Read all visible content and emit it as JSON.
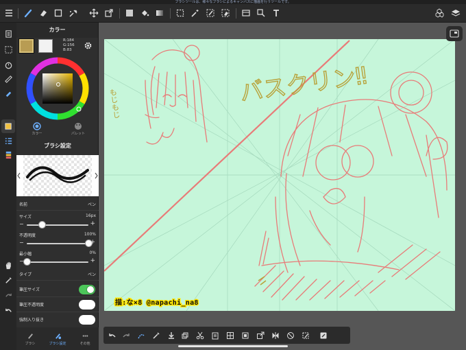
{
  "status_bar": {
    "text": "ブラシツールは、様々なブラシによるキャンバスに描画を行うツールです。"
  },
  "toolbar": {
    "items": [
      "menu",
      "brush",
      "eraser",
      "rect-select",
      "magic-wand",
      "transform",
      "move",
      "fill-color",
      "bucket",
      "gradient",
      "lasso",
      "wand-select",
      "select-pen",
      "select-eraser",
      "material",
      "paste",
      "text",
      "view-mode",
      "layers"
    ]
  },
  "color_panel": {
    "title": "カラー",
    "main_color": "#b89c53",
    "sub_color": "#f2f2f2",
    "r": "R:184",
    "g": "G:156",
    "b": "B:83",
    "tab_color": "カラー",
    "tab_palette": "パレット"
  },
  "brush_panel": {
    "title": "ブラシ設定",
    "name_label": "名前",
    "name_value": "ペン",
    "size_label": "サイズ",
    "size_value": "16px",
    "opacity_label": "不透明度",
    "opacity_value": "100%",
    "min_width_label": "最小幅",
    "min_width_value": "0%",
    "type_label": "タイプ",
    "type_value": "ペン",
    "pressure_size_label": "筆圧サイズ",
    "pressure_size_on": true,
    "pressure_opacity_label": "筆圧不透明度",
    "pressure_opacity_on": false,
    "force_fade_label": "強制入り抜き",
    "force_fade_on": false,
    "size_fraction": 0.25,
    "opacity_fraction": 1.0,
    "min_width_fraction": 0.0
  },
  "bottom_tabs": {
    "brush": "ブラシ",
    "brush_settings": "ブラシ設定",
    "other": "その他"
  },
  "artwork": {
    "title_text": "バスクリン‼",
    "side_text": "もじもじ",
    "credit": "描:な×8 @napachi_na8"
  },
  "colors": {
    "accent": "#6db0ff",
    "toggle_on": "#4cc65a",
    "canvas": "#c6f6da",
    "sketch": "#e87b78",
    "lettering": "#b8a23a"
  }
}
